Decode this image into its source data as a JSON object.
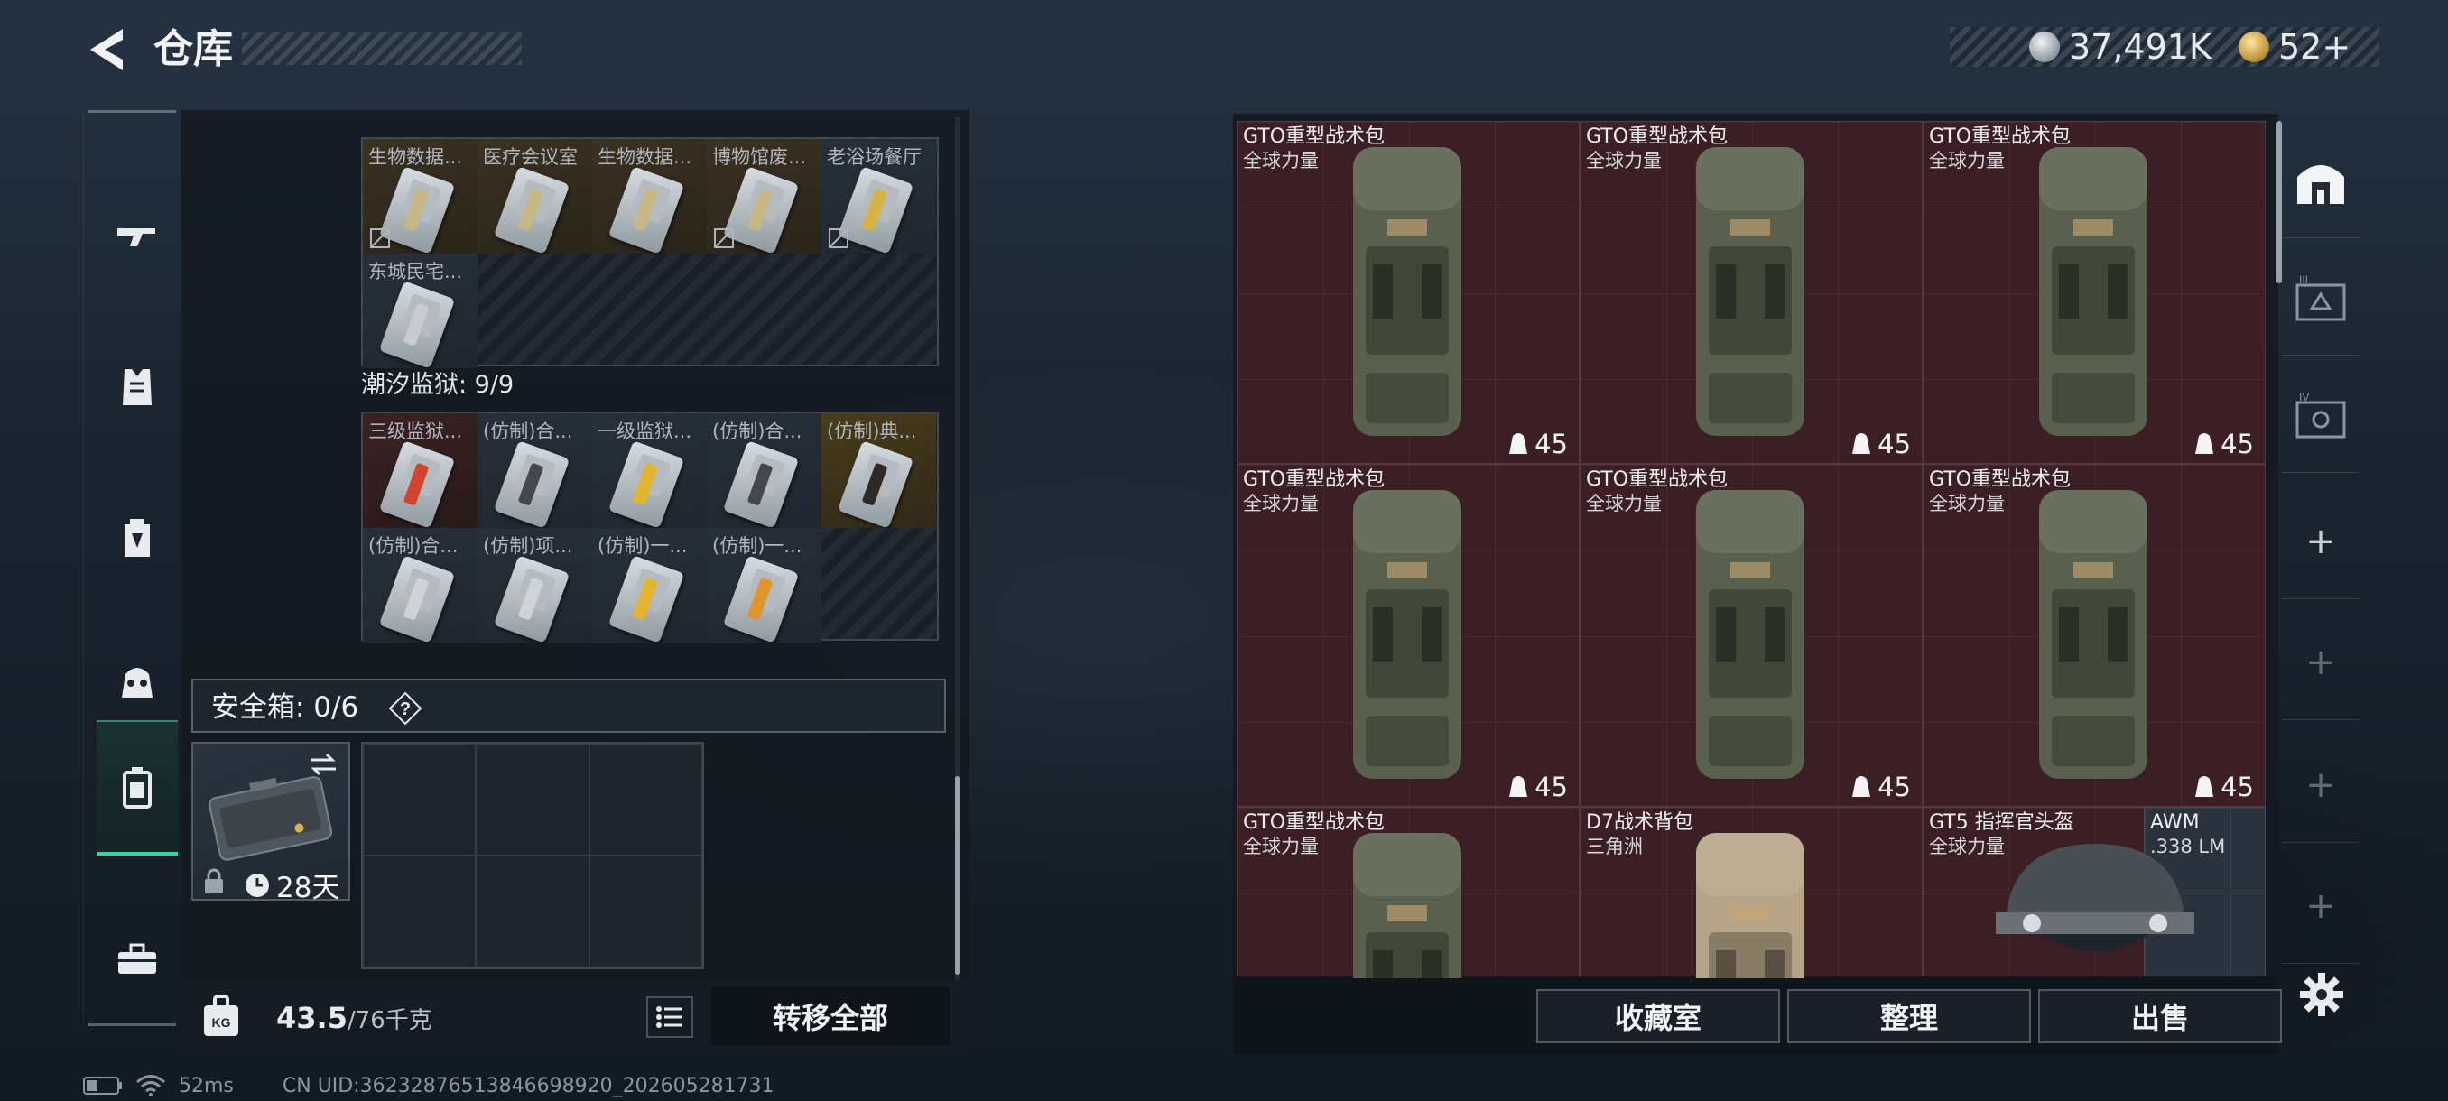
{
  "header": {
    "title": "仓库",
    "currency_silver": "37,491K",
    "currency_gold": "52+"
  },
  "left_nav": {
    "items": [
      {
        "icon": "rifle-icon"
      },
      {
        "icon": "armor-vest-icon"
      },
      {
        "icon": "backpack-icon"
      },
      {
        "icon": "helmet-icon"
      },
      {
        "icon": "safe-box-icon"
      },
      {
        "icon": "toolbox-icon"
      }
    ]
  },
  "card_section_1": {
    "cards": [
      {
        "label": "生物数据...",
        "bg": "orange",
        "stripe": "#c7b784",
        "locked": true
      },
      {
        "label": "医疗会议室",
        "bg": "orange",
        "stripe": "#c7b784",
        "locked": false
      },
      {
        "label": "生物数据...",
        "bg": "orange",
        "stripe": "#c7b784",
        "locked": false
      },
      {
        "label": "博物馆废...",
        "bg": "orange",
        "stripe": "#c7b784",
        "locked": true
      },
      {
        "label": "老浴场餐厅",
        "bg": "gray",
        "stripe": "#d6b443",
        "locked": true
      },
      {
        "label": "东城民宅...",
        "bg": "gray",
        "stripe": "#c8ccd0",
        "locked": false
      }
    ]
  },
  "card_section_2": {
    "title": "潮汐监狱: 9/9",
    "cards": [
      {
        "label": "三级监狱...",
        "bg": "red",
        "stripe": "#d2452c",
        "locked": false
      },
      {
        "label": "(仿制)合...",
        "bg": "gray",
        "stripe": "#44484c",
        "locked": false
      },
      {
        "label": "一级监狱...",
        "bg": "gray",
        "stripe": "#e2b52c",
        "locked": false
      },
      {
        "label": "(仿制)合...",
        "bg": "gray",
        "stripe": "#44484c",
        "locked": false
      },
      {
        "label": "(仿制)典...",
        "bg": "yellow",
        "stripe": "#2c2a22",
        "locked": false
      },
      {
        "label": "(仿制)合...",
        "bg": "gray",
        "stripe": "#cfd3d6",
        "locked": false
      },
      {
        "label": "(仿制)项...",
        "bg": "gray",
        "stripe": "#cfd3d6",
        "locked": false
      },
      {
        "label": "(仿制)一...",
        "bg": "gray",
        "stripe": "#e2b52c",
        "locked": false
      },
      {
        "label": "(仿制)一...",
        "bg": "gray",
        "stripe": "#e2942c",
        "locked": false
      }
    ]
  },
  "safe_box": {
    "label": "安全箱: 0/6",
    "help": "?",
    "item_days": "28天"
  },
  "bottom_left": {
    "weight_current": "43.5",
    "weight_max": "/76千克",
    "transfer_label": "转移全部"
  },
  "status": {
    "ping": "52ms",
    "uid": "CN UID:36232876513846698920_202605281731"
  },
  "storage": {
    "items": [
      {
        "name": "GTO重型战术包",
        "sub": "全球力量",
        "cap": "45",
        "type": "backpack",
        "color": "#59604d"
      },
      {
        "name": "GTO重型战术包",
        "sub": "全球力量",
        "cap": "45",
        "type": "backpack",
        "color": "#59604d"
      },
      {
        "name": "GTO重型战术包",
        "sub": "全球力量",
        "cap": "45",
        "type": "backpack",
        "color": "#59604d"
      },
      {
        "name": "GTO重型战术包",
        "sub": "全球力量",
        "cap": "45",
        "type": "backpack",
        "color": "#59604d"
      },
      {
        "name": "GTO重型战术包",
        "sub": "全球力量",
        "cap": "45",
        "type": "backpack",
        "color": "#59604d"
      },
      {
        "name": "GTO重型战术包",
        "sub": "全球力量",
        "cap": "45",
        "type": "backpack",
        "color": "#59604d"
      },
      {
        "name": "GTO重型战术包",
        "sub": "全球力量",
        "cap": "",
        "type": "backpack",
        "color": "#59604d"
      },
      {
        "name": "D7战术背包",
        "sub": "三角洲",
        "cap": "",
        "type": "backpack",
        "color": "#b5a487"
      },
      {
        "name": "GT5 指挥官头盔",
        "sub": "全球力量",
        "cap": "",
        "type": "helmet",
        "color": "#4a4f53"
      },
      {
        "name": "AWM",
        "sub": ".338 LM",
        "cap": "",
        "type": "ammo",
        "color": "#2a333d"
      }
    ]
  },
  "bottom_right": {
    "collection_label": "收藏室",
    "sort_label": "整理",
    "sell_label": "出售"
  },
  "right_nav": {
    "items": [
      {
        "icon": "storage-icon"
      },
      {
        "icon": "storage-3-icon"
      },
      {
        "icon": "storage-4-icon"
      },
      {
        "icon": "add-icon",
        "label": "+"
      },
      {
        "icon": "add-icon",
        "label": "+"
      },
      {
        "icon": "add-icon",
        "label": "+"
      },
      {
        "icon": "add-icon",
        "label": "+"
      }
    ]
  }
}
